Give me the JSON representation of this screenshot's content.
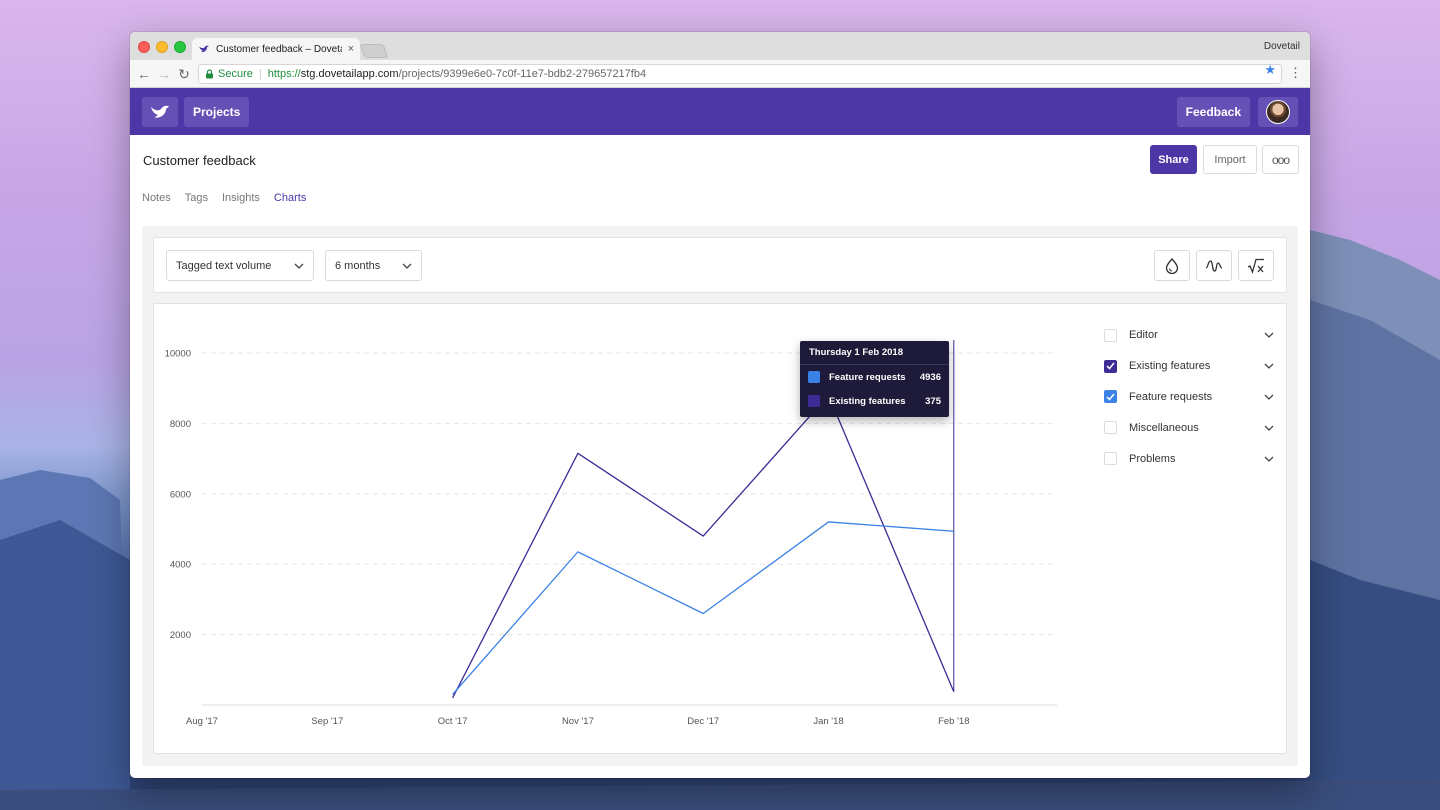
{
  "browser": {
    "tab_title": "Customer feedback – Dovetail",
    "tab_close": "×",
    "profile_name": "Dovetail",
    "secure_label": "Secure",
    "url_scheme": "https://",
    "url_host": "stg.dovetailapp.com",
    "url_path": "/projects/9399e6e0-7c0f-11e7-bdb2-279657217fb4",
    "back": "←",
    "forward": "→",
    "reload": "↻",
    "menu": "⋮",
    "star": "★"
  },
  "app": {
    "projects_label": "Projects",
    "feedback_label": "Feedback",
    "brand_color": "#4d37a6"
  },
  "page": {
    "title": "Customer feedback",
    "share_label": "Share",
    "import_label": "Import",
    "more_label": "ooo",
    "tabs": [
      {
        "label": "Notes",
        "active": false
      },
      {
        "label": "Tags",
        "active": false
      },
      {
        "label": "Insights",
        "active": false
      },
      {
        "label": "Charts",
        "active": true
      }
    ]
  },
  "filters": {
    "metric": "Tagged text volume",
    "range": "6 months",
    "chevron": "⌄",
    "icons": [
      "drop-icon",
      "wave-icon",
      "sqrt-x-icon"
    ]
  },
  "legend": [
    {
      "label": "Editor",
      "checked": false,
      "color": ""
    },
    {
      "label": "Existing features",
      "checked": true,
      "color": "#3f2b96"
    },
    {
      "label": "Feature requests",
      "checked": true,
      "color": "#3b82e6"
    },
    {
      "label": "Miscellaneous",
      "checked": false,
      "color": ""
    },
    {
      "label": "Problems",
      "checked": false,
      "color": ""
    }
  ],
  "tooltip": {
    "title": "Thursday 1 Feb 2018",
    "rows": [
      {
        "label": "Feature requests",
        "value": "4936",
        "color": "#3b82e6"
      },
      {
        "label": "Existing features",
        "value": "375",
        "color": "#3f2b96"
      }
    ]
  },
  "chart_data": {
    "type": "line",
    "x": [
      "Aug '17",
      "Sep '17",
      "Oct '17",
      "Nov '17",
      "Dec '17",
      "Jan '18",
      "Feb '18"
    ],
    "ylim": [
      0,
      10000
    ],
    "yticks": [
      "2000",
      "4000",
      "6000",
      "8000",
      "10000"
    ],
    "grid": true,
    "hover_x": "Feb '18",
    "series": [
      {
        "name": "Existing features",
        "color": "#3f2b96",
        "values": [
          null,
          null,
          200,
          7150,
          4800,
          8800,
          375
        ]
      },
      {
        "name": "Feature requests",
        "color": "#3b82e6",
        "values": [
          null,
          null,
          300,
          4350,
          2600,
          5200,
          4936
        ]
      }
    ]
  }
}
